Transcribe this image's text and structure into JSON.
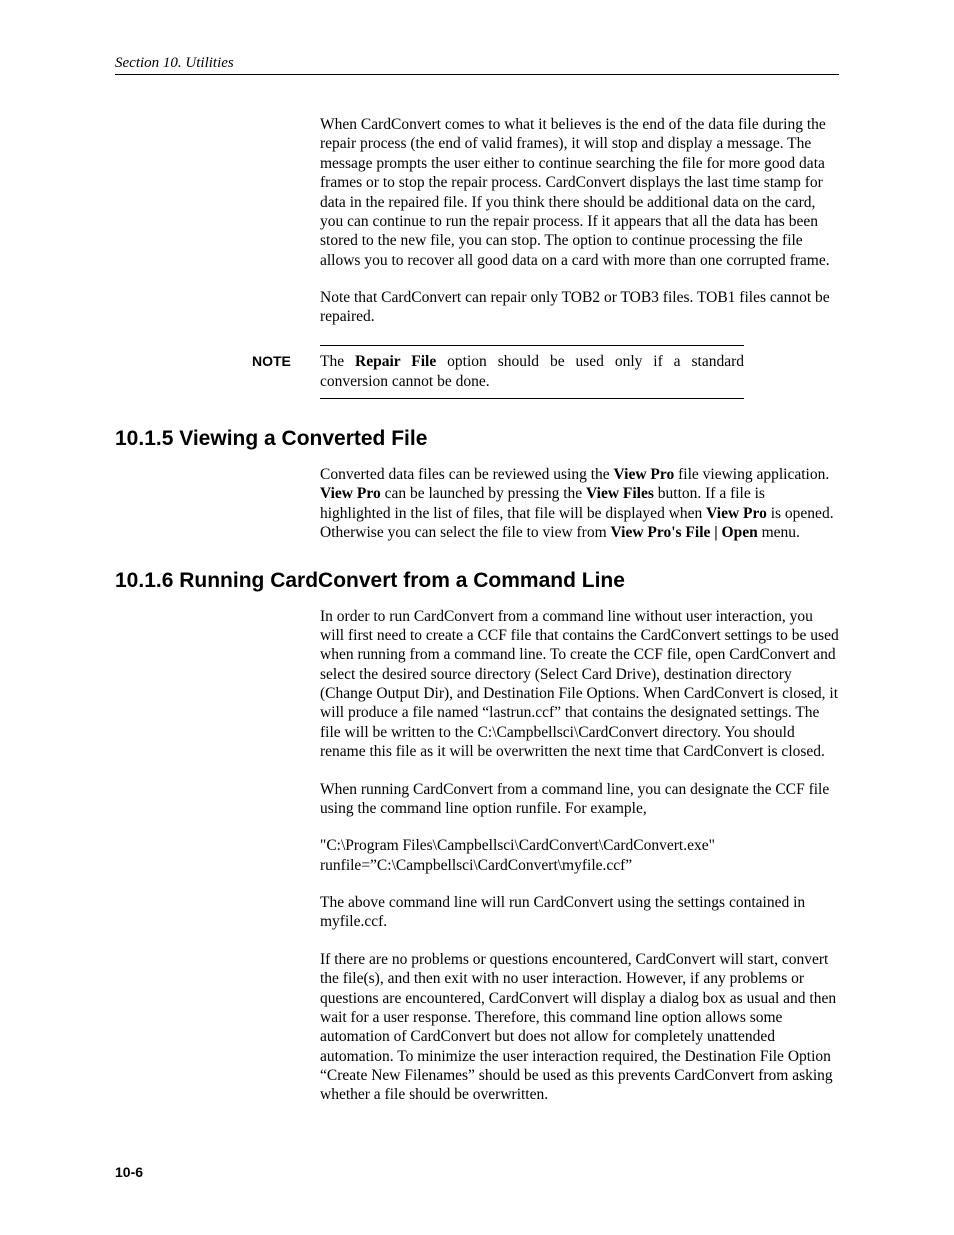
{
  "header": {
    "running": "Section 10.  Utilities"
  },
  "intro": {
    "p1_a": "When CardConvert comes to what it believes is the end of the data file during the repair process (the end of valid frames), it will stop and display a message.  The message prompts the user either to continue searching the file for more good data frames or to stop the repair process.  CardConvert displays the last time stamp for data in the repaired file.  If you think there should be additional data on the card, you can continue to run the repair process.  If it appears that all the data has been stored to the new file, you can stop.  The option to continue processing the file allows you to recover all good data on a card with more than one corrupted frame.",
    "p2": "Note that CardConvert can repair only TOB2 or TOB3 files. TOB1 files cannot be repaired."
  },
  "note": {
    "label": "NOTE",
    "text_a": "The ",
    "bold": "Repair File",
    "text_b": " option should be used only if a standard conversion cannot be done."
  },
  "s1": {
    "heading": "10.1.5  Viewing a Converted File",
    "p_a": "Converted data files can be reviewed using the ",
    "b1": "View Pro",
    "p_b": " file viewing application.  ",
    "b2": "View Pro",
    "p_c": " can be launched by pressing the ",
    "b3": "View Files",
    "p_d": " button.  If a file is highlighted in the list of files, that file will be displayed when ",
    "b4": "View Pro",
    "p_e": " is opened.  Otherwise you can select the file to view from ",
    "b5": "View Pro's File | Open",
    "p_f": " menu."
  },
  "s2": {
    "heading": "10.1.6  Running CardConvert from a Command Line",
    "p1": "In order to run CardConvert from a command line without user interaction, you will first need to create a CCF file that contains the CardConvert settings to be used when running from a command line.  To create the CCF file, open CardConvert and select the desired source directory (Select Card Drive), destination directory (Change Output Dir), and Destination File Options. When CardConvert is closed, it will produce a file named “lastrun.ccf” that contains the designated settings. The file will be written to the C:\\Campbellsci\\CardConvert directory. You should rename this file as it will be overwritten the next time that CardConvert is closed.",
    "p2": "When running CardConvert from a command line, you can designate the CCF file using the command line option runfile.  For example,",
    "p3": "\"C:\\Program Files\\Campbellsci\\CardConvert\\CardConvert.exe\" runfile=”C:\\Campbellsci\\CardConvert\\myfile.ccf”",
    "p4": "The above command line will run CardConvert using the settings contained in myfile.ccf.",
    "p5": "If there are no problems or questions encountered, CardConvert will start, convert the file(s), and then exit with no user interaction. However, if any problems or questions are encountered, CardConvert will display a dialog box as usual and then wait for a user response. Therefore, this command line option allows some automation of CardConvert but does not allow for completely unattended automation. To minimize the user interaction required, the Destination File Option “Create New Filenames” should be used as this prevents CardConvert from asking whether a file should be overwritten."
  },
  "footer": {
    "page": "10-6"
  }
}
